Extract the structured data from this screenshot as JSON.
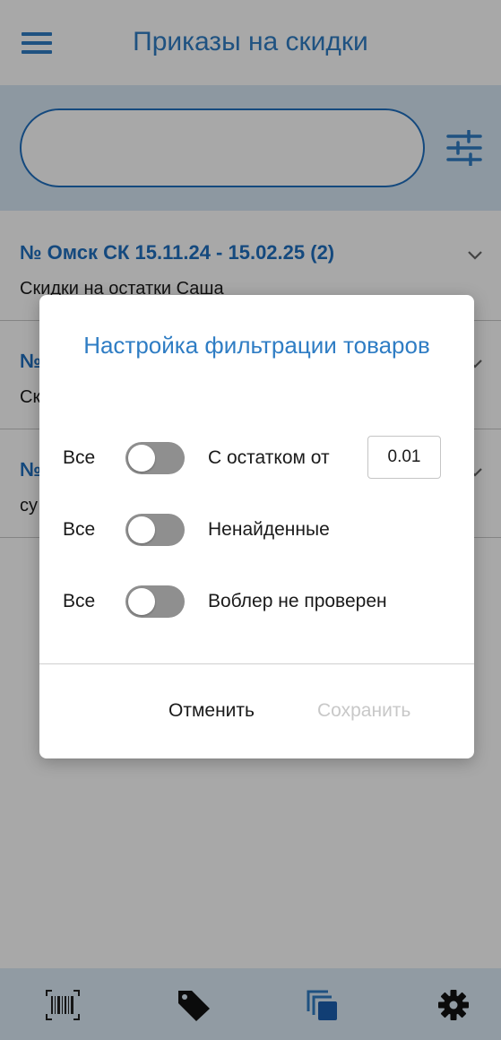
{
  "header": {
    "title": "Приказы на скидки"
  },
  "search": {
    "placeholder": ""
  },
  "list": [
    {
      "title": "№ Омск СК  15.11.24 - 15.02.25  (2)",
      "subtitle": "Скидки на остатки Саша"
    },
    {
      "title": "№",
      "subtitle": "Ск"
    },
    {
      "title": "№",
      "subtitle": "су"
    }
  ],
  "dialog": {
    "title": "Настройка фильтрации товаров",
    "rows": [
      {
        "left": "Все",
        "label": "С остатком от",
        "value": "0.01",
        "enabled": false
      },
      {
        "left": "Все",
        "label": "Ненайденные",
        "enabled": false
      },
      {
        "left": "Все",
        "label": "Воблер не проверен",
        "enabled": false
      }
    ],
    "cancel": "Отменить",
    "save": "Сохранить"
  },
  "colors": {
    "accent": "#2f7dc4",
    "title_blue": "#1f6fbf",
    "toggle_off": "#8f8f8f",
    "disabled_text": "#c8c8c8",
    "nav_bg": "#dcebf7"
  },
  "bottom_nav": {
    "icons": [
      "barcode-icon",
      "tag-icon",
      "layers-icon",
      "gear-icon"
    ]
  }
}
